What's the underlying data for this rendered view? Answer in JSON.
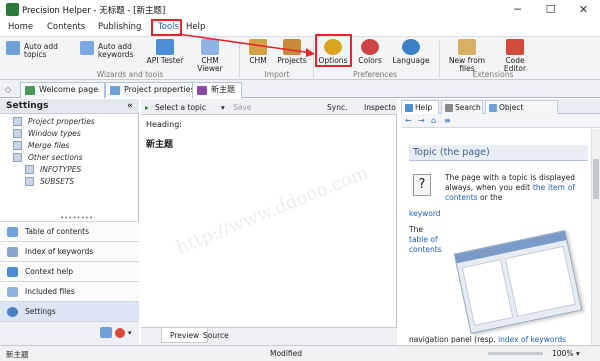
{
  "window": {
    "title": "Precision Helper - 无标题 - [新主题]",
    "controls": [
      "─",
      "☐",
      "✕"
    ]
  },
  "menu": [
    "Home",
    "Contents",
    "Publishing",
    "Tools",
    "Help"
  ],
  "ribbon": {
    "buttons": {
      "auto_add_topics": "Auto add\ntopics",
      "auto_add_keywords": "Auto add\nkeywords",
      "api_tester": "API Tester",
      "chm_viewer": "CHM Viewer",
      "chm": "CHM",
      "projects": "Projects",
      "options": "Options",
      "colors": "Colors",
      "language": "Language",
      "new_from_files": "New from files",
      "code_editor": "Code Editor"
    },
    "groups": {
      "wizards": "Wizards and tools",
      "import": "Import",
      "preferences": "Preferences",
      "extensions": "Extensions"
    }
  },
  "tabs": [
    "Welcome page",
    "Project properties",
    "新主题"
  ],
  "sidebar": {
    "title": "Settings",
    "tree": [
      "Project properties",
      "Window types",
      "Merge files",
      "Other sections",
      "INFOTYPES",
      "SUBSETS"
    ],
    "nav": [
      "Table of contents",
      "Index of keywords",
      "Context help",
      "Included files",
      "Settings"
    ]
  },
  "center": {
    "select_topic": "Select a topic",
    "save": "Save",
    "sync": "Sync.",
    "inspector": "Inspecto",
    "heading_label": "Heading:",
    "heading_value": "新主题",
    "bottom_tabs": [
      "Preview",
      "Source"
    ]
  },
  "right": {
    "tabs": [
      "Help",
      "Search",
      "Object Inspector"
    ],
    "topic_title": "Topic (the page)",
    "para1_a": "The page with a topic is displayed always, when you edit",
    "para1_link1": "the item of contents",
    "para1_or": "or the",
    "para1_link2": "keyword",
    "para2_a": "The",
    "para2_link": "table of contents",
    "para3": "navigation panel (resp.",
    "para3_link": "index of keywords"
  },
  "status": {
    "left": "新主题",
    "center": "Modified",
    "zoom": "100%"
  },
  "watermark": "http://www.ddooo.com"
}
